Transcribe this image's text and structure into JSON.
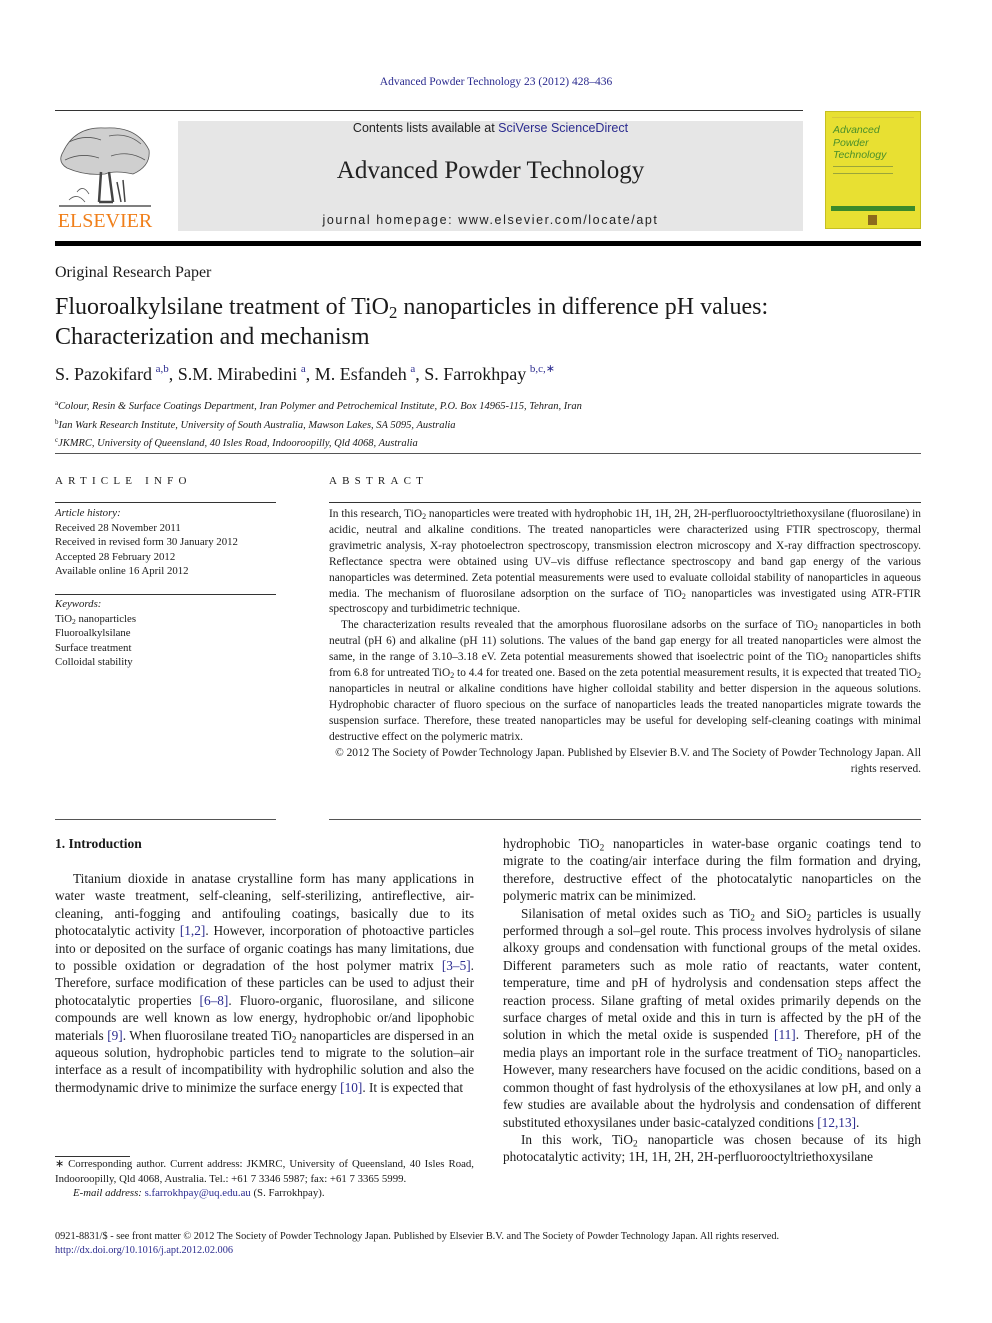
{
  "running_head": "Advanced Powder Technology 23 (2012) 428–436",
  "masthead": {
    "publisher_logo_text": "ELSEVIER",
    "contents_prefix": "Contents lists available at ",
    "contents_link": "SciVerse ScienceDirect",
    "journal_title": "Advanced Powder Technology",
    "homepage": "journal homepage: www.elsevier.com/locate/apt",
    "cover_title_lines": [
      "Advanced",
      "Powder",
      "Technology"
    ]
  },
  "colors": {
    "link": "#2b2b8f",
    "elsevier_orange": "#f07f1a",
    "masthead_bg": "#e6e6e6",
    "cover_yellow": "#e8e032",
    "cover_green": "#4a8f2a"
  },
  "article": {
    "type": "Original Research Paper",
    "title_part1": "Fluoroalkylsilane treatment of TiO",
    "title_sub": "2",
    "title_part2": " nanoparticles in difference pH values:",
    "title_line2": "Characterization and mechanism",
    "authors": [
      {
        "name": "S. Pazokifard",
        "sup": "a,b",
        "sep": ", "
      },
      {
        "name": "S.M. Mirabedini",
        "sup": "a",
        "sep": ", "
      },
      {
        "name": "M. Esfandeh",
        "sup": "a",
        "sep": ", "
      },
      {
        "name": "S. Farrokhpay",
        "sup": "b,c,∗",
        "sep": ""
      }
    ],
    "affiliations": [
      {
        "mark": "a",
        "text": "Colour, Resin & Surface Coatings Department, Iran Polymer and Petrochemical Institute, P.O. Box 14965-115, Tehran, Iran"
      },
      {
        "mark": "b",
        "text": "Ian Wark Research Institute, University of South Australia, Mawson Lakes, SA 5095, Australia"
      },
      {
        "mark": "c",
        "text": "JKMRC, University of Queensland, 40 Isles Road, Indooroopilly, Qld 4068, Australia"
      }
    ]
  },
  "article_info": {
    "heading": "ARTICLE INFO",
    "history_label": "Article history:",
    "history": [
      "Received 28 November 2011",
      "Received in revised form 30 January 2012",
      "Accepted 28 February 2012",
      "Available online 16 April 2012"
    ],
    "keywords_label": "Keywords:",
    "keywords": [
      "TiO2 nanoparticles",
      "Fluoroalkylsilane",
      "Surface treatment",
      "Colloidal stability"
    ]
  },
  "abstract": {
    "heading": "ABSTRACT",
    "p1": "In this research, TiO₂ nanoparticles were treated with hydrophobic 1H, 1H, 2H, 2H-perfluorooctyltriethoxysilane (fluorosilane) in acidic, neutral and alkaline conditions. The treated nanoparticles were characterized using FTIR spectroscopy, thermal gravimetric analysis, X-ray photoelectron spectroscopy, transmission electron microscopy and X-ray diffraction spectroscopy. Reflectance spectra were obtained using UV–vis diffuse reflectance spectroscopy and band gap energy of the various nanoparticles was determined. Zeta potential measurements were used to evaluate colloidal stability of nanoparticles in aqueous media. The mechanism of fluorosilane adsorption on the surface of TiO₂ nanoparticles was investigated using ATR-FTIR spectroscopy and turbidimetric technique.",
    "p2": "The characterization results revealed that the amorphous fluorosilane adsorbs on the surface of TiO₂ nanoparticles in both neutral (pH 6) and alkaline (pH 11) solutions. The values of the band gap energy for all treated nanoparticles were almost the same, in the range of 3.10–3.18 eV. Zeta potential measurements showed that isoelectric point of the TiO₂ nanoparticles shifts from 6.8 for untreated TiO₂ to 4.4 for treated one. Based on the zeta potential measurement results, it is expected that treated TiO₂ nanoparticles in neutral or alkaline conditions have higher colloidal stability and better dispersion in the aqueous solutions. Hydrophobic character of fluoro specious on the surface of nanoparticles leads the treated nanoparticles migrate towards the suspension surface. Therefore, these treated nanoparticles may be useful for developing self-cleaning coatings with minimal destructive effect on the polymeric matrix.",
    "copyright": "© 2012 The Society of Powder Technology Japan. Published by Elsevier B.V. and The Society of Powder Technology Japan. All rights reserved."
  },
  "body": {
    "intro_heading": "1. Introduction",
    "left_p1": [
      {
        "t": "Titanium dioxide in anatase crystalline form has many applications in water waste treatment, self-cleaning, self-sterilizing, antireflective, air-cleaning, anti-fogging and antifouling coatings, basically due to its photocatalytic activity "
      },
      {
        "ref": "[1,2]"
      },
      {
        "t": ". However, incorporation of photoactive particles into or deposited on the surface of organic coatings has many limitations, due to possible oxidation or degradation of the host polymer matrix "
      },
      {
        "ref": "[3–5]"
      },
      {
        "t": ". Therefore, surface modification of these particles can be used to adjust their photocatalytic properties "
      },
      {
        "ref": "[6–8]"
      },
      {
        "t": ". Fluoro-organic, fluorosilane, and silicone compounds are well known as low energy, hydrophobic or/and lipophobic materials "
      },
      {
        "ref": "[9]"
      },
      {
        "t": ". When fluorosilane treated TiO₂ nanoparticles are dispersed in an aqueous solution, hydrophobic particles tend to migrate to the solution–air interface as a result of incompatibility with hydrophilic solution and also the thermodynamic drive to minimize the surface energy "
      },
      {
        "ref": "[10]"
      },
      {
        "t": ". It is expected that"
      }
    ],
    "right_p1": [
      {
        "t": "hydrophobic TiO₂ nanoparticles in water-base organic coatings tend to migrate to the coating/air interface during the film formation and drying, therefore, destructive effect of the photocatalytic nanoparticles on the polymeric matrix can be minimized."
      }
    ],
    "right_p2": [
      {
        "t": "Silanisation of metal oxides such as TiO₂ and SiO₂ particles is usually performed through a sol–gel route. This process involves hydrolysis of silane alkoxy groups and condensation with functional groups of the metal oxides. Different parameters such as mole ratio of reactants, water content, temperature, time and pH of hydrolysis and condensation steps affect the reaction process. Silane grafting of metal oxides primarily depends on the surface charges of metal oxide and this in turn is affected by the pH of the solution in which the metal oxide is suspended "
      },
      {
        "ref": "[11]"
      },
      {
        "t": ". Therefore, pH of the media plays an important role in the surface treatment of TiO₂ nanoparticles. However, many researchers have focused on the acidic conditions, based on a common thought of fast hydrolysis of the ethoxysilanes at low pH, and only a few studies are available about the hydrolysis and condensation of different substituted ethoxysilanes under basic-catalyzed conditions "
      },
      {
        "ref": "[12,13]"
      },
      {
        "t": "."
      }
    ],
    "right_p3": [
      {
        "t": "In this work, TiO₂ nanoparticle was chosen because of its high photocatalytic activity; 1H, 1H, 2H, 2H-perfluorooctyltriethoxysilane"
      }
    ]
  },
  "footnote": {
    "corresponding": "∗ Corresponding author. Current address: JKMRC, University of Queensland, 40 Isles Road, Indooroopilly, Qld 4068, Australia. Tel.: +61 7 3346 5987; fax: +61 7 3365 5999.",
    "email_label": "E-mail address: ",
    "email": "s.farrokhpay@uq.edu.au",
    "email_suffix": " (S. Farrokhpay)."
  },
  "bottom": {
    "issn_line": "0921-8831/$ - see front matter © 2012 The Society of Powder Technology Japan. Published by Elsevier B.V. and The Society of Powder Technology Japan. All rights reserved.",
    "doi": "http://dx.doi.org/10.1016/j.apt.2012.02.006"
  }
}
